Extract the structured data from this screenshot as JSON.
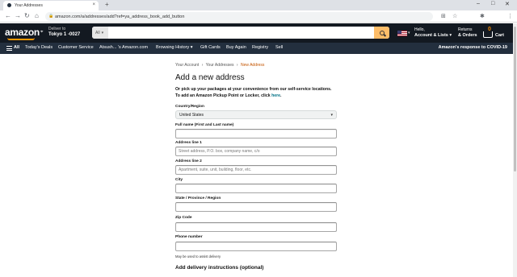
{
  "browser": {
    "tab_title": "Your Addresses",
    "tab_close": "×",
    "new_tab": "+",
    "url": "amazon.com/a/addresses/add?ref=ya_address_book_add_button",
    "minimize": "–",
    "maximize": "□",
    "close": "✕",
    "back": "←",
    "forward": "→",
    "reload": "↻",
    "home": "⌂",
    "translate": "⊞",
    "star": "☆",
    "puzzle": "✱",
    "menu": "⋮",
    "lock": "🔒"
  },
  "header": {
    "logo": "amazon",
    "deliver_line1": "Deliver to",
    "deliver_line2": "Tokyo 1  -0027",
    "search_category": "All",
    "search_placeholder": "",
    "flag_caret": "▾",
    "account_line1": "Hello,",
    "account_line2": "Account & Lists ▾",
    "orders_line1": "Returns",
    "orders_line2": "& Orders",
    "cart_count": "0",
    "cart_label": "Cart"
  },
  "nav": {
    "all": "All",
    "items": [
      "Today's Deals",
      "Customer Service",
      "Atsush... 's Amazon.com",
      "Browsing History ▾",
      "Gift Cards",
      "Buy Again",
      "Registry",
      "Sell"
    ],
    "covid": "Amazon's response to COVID-19"
  },
  "breadcrumb": {
    "items": [
      "Your Account",
      "Your Addresses"
    ],
    "current": "New Address",
    "sep": "›"
  },
  "form": {
    "title": "Add a new address",
    "pickup_text": "Or pick up your packages at your convenience from our self-service locations. To add an Amazon Pickup Point or Locker, click ",
    "pickup_link": "here",
    "pickup_end": ".",
    "country_label": "Country/Region",
    "country_value": "United States",
    "fullname_label": "Full name (First and Last name)",
    "address1_label": "Address line 1",
    "address1_placeholder": "Street address, P.O. box, company name, c/o",
    "address2_label": "Address line 2",
    "address2_placeholder": "Apartment, suite, unit, building, floor, etc.",
    "city_label": "City",
    "state_label": "State / Province / Region",
    "zip_label": "Zip Code",
    "phone_label": "Phone number",
    "phone_hint": "May be used to assist delivery",
    "delivery_title": "Add delivery instructions (optional)"
  },
  "colors": {
    "header_bg": "#131921",
    "nav_bg": "#232f3e",
    "search_button": "#febd69",
    "accent_orange": "#f90",
    "link": "#007185",
    "breadcrumb_current": "#c45500"
  }
}
